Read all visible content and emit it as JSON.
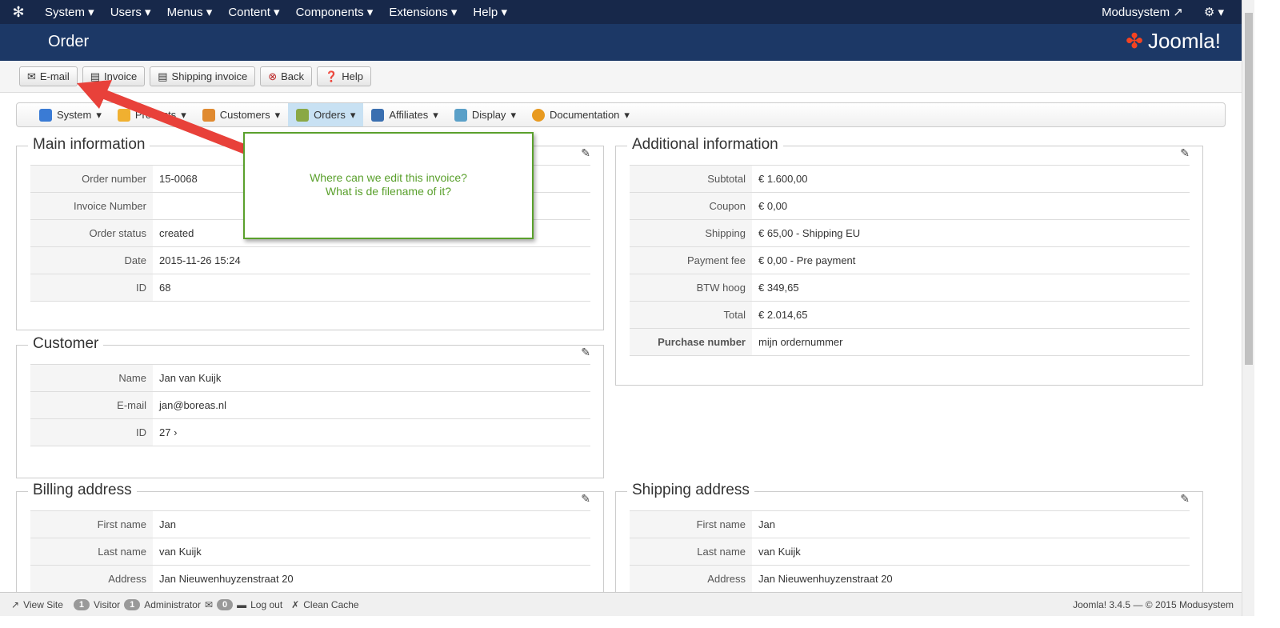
{
  "topnav": {
    "items": [
      "System",
      "Users",
      "Menus",
      "Content",
      "Components",
      "Extensions",
      "Help"
    ],
    "user": "Modusystem"
  },
  "header": {
    "title": "Order",
    "brand": "Joomla!"
  },
  "toolbar": {
    "email": "E-mail",
    "invoice": "Invoice",
    "shipping_invoice": "Shipping invoice",
    "back": "Back",
    "help": "Help"
  },
  "submenu": [
    {
      "label": "System",
      "icon": "tools-icon",
      "color": "#3a7bd5"
    },
    {
      "label": "Products",
      "icon": "products-icon",
      "color": "#f0b030"
    },
    {
      "label": "Customers",
      "icon": "customers-icon",
      "color": "#e08a30"
    },
    {
      "label": "Orders",
      "icon": "orders-icon",
      "color": "#8aa845"
    },
    {
      "label": "Affiliates",
      "icon": "affiliates-icon",
      "color": "#3a6fb0"
    },
    {
      "label": "Display",
      "icon": "display-icon",
      "color": "#5aa0c8"
    },
    {
      "label": "Documentation",
      "icon": "lifebuoy-icon",
      "color": "#e89a20"
    }
  ],
  "main_info": {
    "title": "Main information",
    "rows": [
      {
        "label": "Order number",
        "value": "15-0068"
      },
      {
        "label": "Invoice Number",
        "value": ""
      },
      {
        "label": "Order status",
        "value": "created"
      },
      {
        "label": "Date",
        "value": "2015-11-26 15:24"
      },
      {
        "label": "ID",
        "value": "68"
      }
    ]
  },
  "customer": {
    "title": "Customer",
    "rows": [
      {
        "label": "Name",
        "value": "Jan van Kuijk"
      },
      {
        "label": "E-mail",
        "value": "jan@boreas.nl"
      },
      {
        "label": "ID",
        "value": "27"
      }
    ]
  },
  "billing": {
    "title": "Billing address",
    "rows": [
      {
        "label": "First name",
        "value": "Jan"
      },
      {
        "label": "Last name",
        "value": "van Kuijk"
      },
      {
        "label": "Address",
        "value": "Jan Nieuwenhuyzenstraat 20"
      }
    ]
  },
  "additional": {
    "title": "Additional information",
    "rows": [
      {
        "label": "Subtotal",
        "value": "€ 1.600,00"
      },
      {
        "label": "Coupon",
        "value": "€ 0,00"
      },
      {
        "label": "Shipping",
        "value": "€ 65,00 - Shipping EU"
      },
      {
        "label": "Payment fee",
        "value": "€ 0,00 - Pre payment"
      },
      {
        "label": "BTW hoog",
        "value": "€ 349,65"
      },
      {
        "label": "Total",
        "value": "€ 2.014,65"
      },
      {
        "label": "Purchase number",
        "value": "mijn ordernummer"
      }
    ]
  },
  "shipping": {
    "title": "Shipping address",
    "rows": [
      {
        "label": "First name",
        "value": "Jan"
      },
      {
        "label": "Last name",
        "value": "van Kuijk"
      },
      {
        "label": "Address",
        "value": "Jan Nieuwenhuyzenstraat 20"
      }
    ]
  },
  "callout": {
    "line1": "Where can we edit this invoice?",
    "line2": "What is de filename of it?"
  },
  "status": {
    "view_site": "View Site",
    "visitors": "1",
    "visitor_label": "Visitor",
    "admins": "1",
    "admin_label": "Administrator",
    "messages": "0",
    "logout": "Log out",
    "clean_cache": "Clean Cache",
    "version": "Joomla! 3.4.5 — © 2015 Modusystem"
  }
}
